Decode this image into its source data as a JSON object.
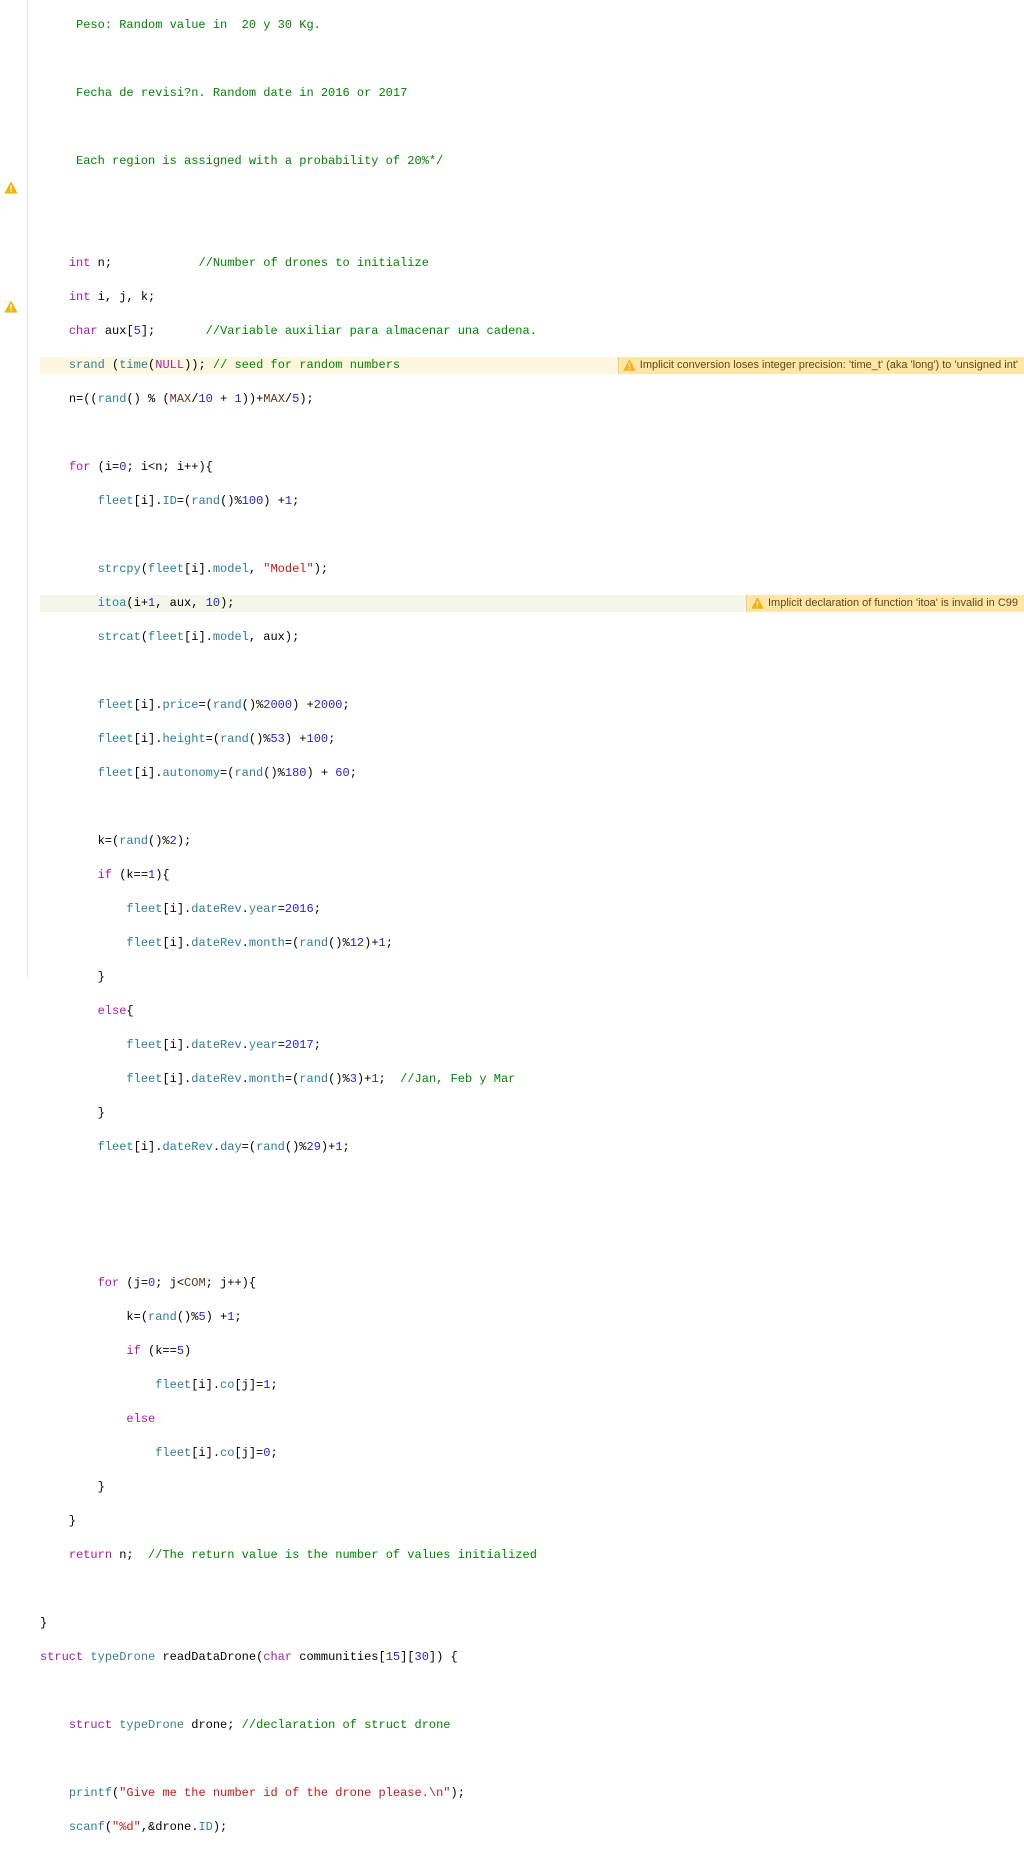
{
  "comments": {
    "peso": "Peso: Random value in  20 y 30 Kg.",
    "fecha": "Fecha de revisi?n. Random date in 2016 or 2017",
    "region": "Each region is assigned with a probability of 20%*/",
    "numDrones": "Number of drones to initialize",
    "varAux": "Variable auxiliar para almacenar una cadena.",
    "seed": "seed for random numbers",
    "janFebMar": "Jan, Feb y Mar",
    "retVal": "The return value is the number of values initialized",
    "declDrone": "declaration of struct drone"
  },
  "warnings": {
    "w1": "Implicit conversion loses integer precision: 'time_t' (aka 'long') to 'unsigned int'",
    "w2": "Implicit declaration of function 'itoa' is invalid in C99"
  },
  "code": {
    "kw_int": "int",
    "kw_char": "char",
    "kw_for": "for",
    "kw_if": "if",
    "kw_else": "else",
    "kw_return": "return",
    "kw_struct": "struct",
    "null": "NULL",
    "n": "n",
    "i": "i",
    "j": "j",
    "k": "k",
    "aux": "aux",
    "srand": "srand",
    "time": "time",
    "rand": "rand",
    "strcpy": "strcpy",
    "itoa": "itoa",
    "strcat": "strcat",
    "printf": "printf",
    "scanf": "scanf",
    "MAX": "MAX",
    "COM": "COM",
    "fleet": "fleet",
    "ID": "ID",
    "model": "model",
    "price": "price",
    "height": "height",
    "autonomy": "autonomy",
    "dateRev": "dateRev",
    "year": "year",
    "month": "month",
    "day": "day",
    "co": "co",
    "typeDrone": "typeDrone",
    "readDataDrone": "readDataDrone",
    "communities": "communities",
    "drone": "drone",
    "str_model": "\"Model\"",
    "str_give": "\"Give me the number id of the drone please.\\n\"",
    "str_d": "\"%d\"",
    "n5": "5",
    "n10": "10",
    "n1": "1",
    "n0": "0",
    "n100": "100",
    "n2000a": "2000",
    "n2000b": "2000",
    "n53": "53",
    "n100b": "100",
    "n180": "180",
    "n60": "60",
    "n2": "2",
    "n2016": "2016",
    "n12": "12",
    "n2017": "2017",
    "n3": "3",
    "n29": "29",
    "n15": "15",
    "n30": "30"
  },
  "icons": {
    "warn": "warning-icon"
  }
}
